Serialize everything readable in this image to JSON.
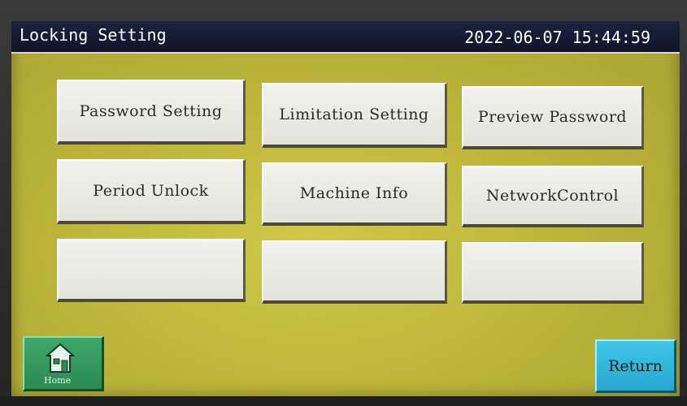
{
  "header": {
    "title": "Locking Setting",
    "datetime": "2022-06-07 15:44:59"
  },
  "buttons": {
    "password_setting": "Password Setting",
    "limitation_setting": "Limitation Setting",
    "preview_password": "Preview Password",
    "period_unlock": "Period Unlock",
    "machine_info": "Machine Info",
    "network_control": "NetworkControl",
    "blank_1": "",
    "blank_2": "",
    "blank_3": ""
  },
  "footer": {
    "home_label": "Home",
    "return_label": "Return"
  },
  "colors": {
    "background": "#bdb63a",
    "titlebar": "#0f1428",
    "button_face": "#e8e8e2",
    "home_button": "#2a8a52",
    "return_button": "#25a8d0"
  },
  "icons": {
    "home": "house-icon"
  }
}
